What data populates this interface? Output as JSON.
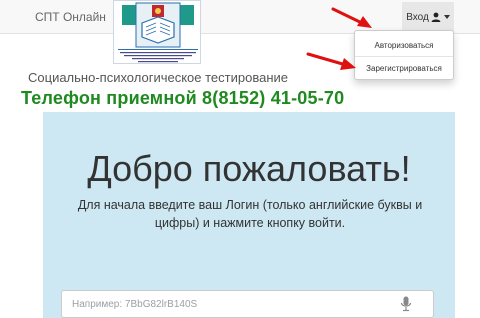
{
  "navbar": {
    "brand": "СПТ Онлайн",
    "login_toggle_label": "Вход",
    "icons": {
      "user": "user-icon",
      "caret": "caret-down-icon"
    }
  },
  "logo": {
    "caption": "ГОСУДАРСТВЕННОЕ АВТОНОМНОЕ УЧРЕЖДЕНИЕ ДОПОЛНИТЕЛЬНОГО ПРОФЕССИОНАЛЬНОГО ОБРАЗОВАНИЯ МУРМАНСКОЙ ОБЛАСТИ «ИНСТИТУТ РАЗВИТИЯ ОБРАЗОВАНИЯ»"
  },
  "dropdown": {
    "items": [
      {
        "label": "Авторизоваться"
      },
      {
        "label": "Зарегистрироваться"
      }
    ]
  },
  "page": {
    "subtitle": "Социально-психологическое тестирование",
    "phone": "Телефон приемной 8(8152) 41-05-70"
  },
  "jumbotron": {
    "title": "Добро пожаловать!",
    "instruction": "Для начала введите ваш Логин (только английские буквы и цифры) и нажмите кнопку войти.",
    "login_placeholder": "Например: 7BbG82lrB140S",
    "login_value": ""
  },
  "colors": {
    "navbar_bg": "#f8f8f8",
    "jumbotron_bg": "#cde8f3",
    "phone_text": "#1f8a1f",
    "annotation_arrow": "#e01010"
  }
}
